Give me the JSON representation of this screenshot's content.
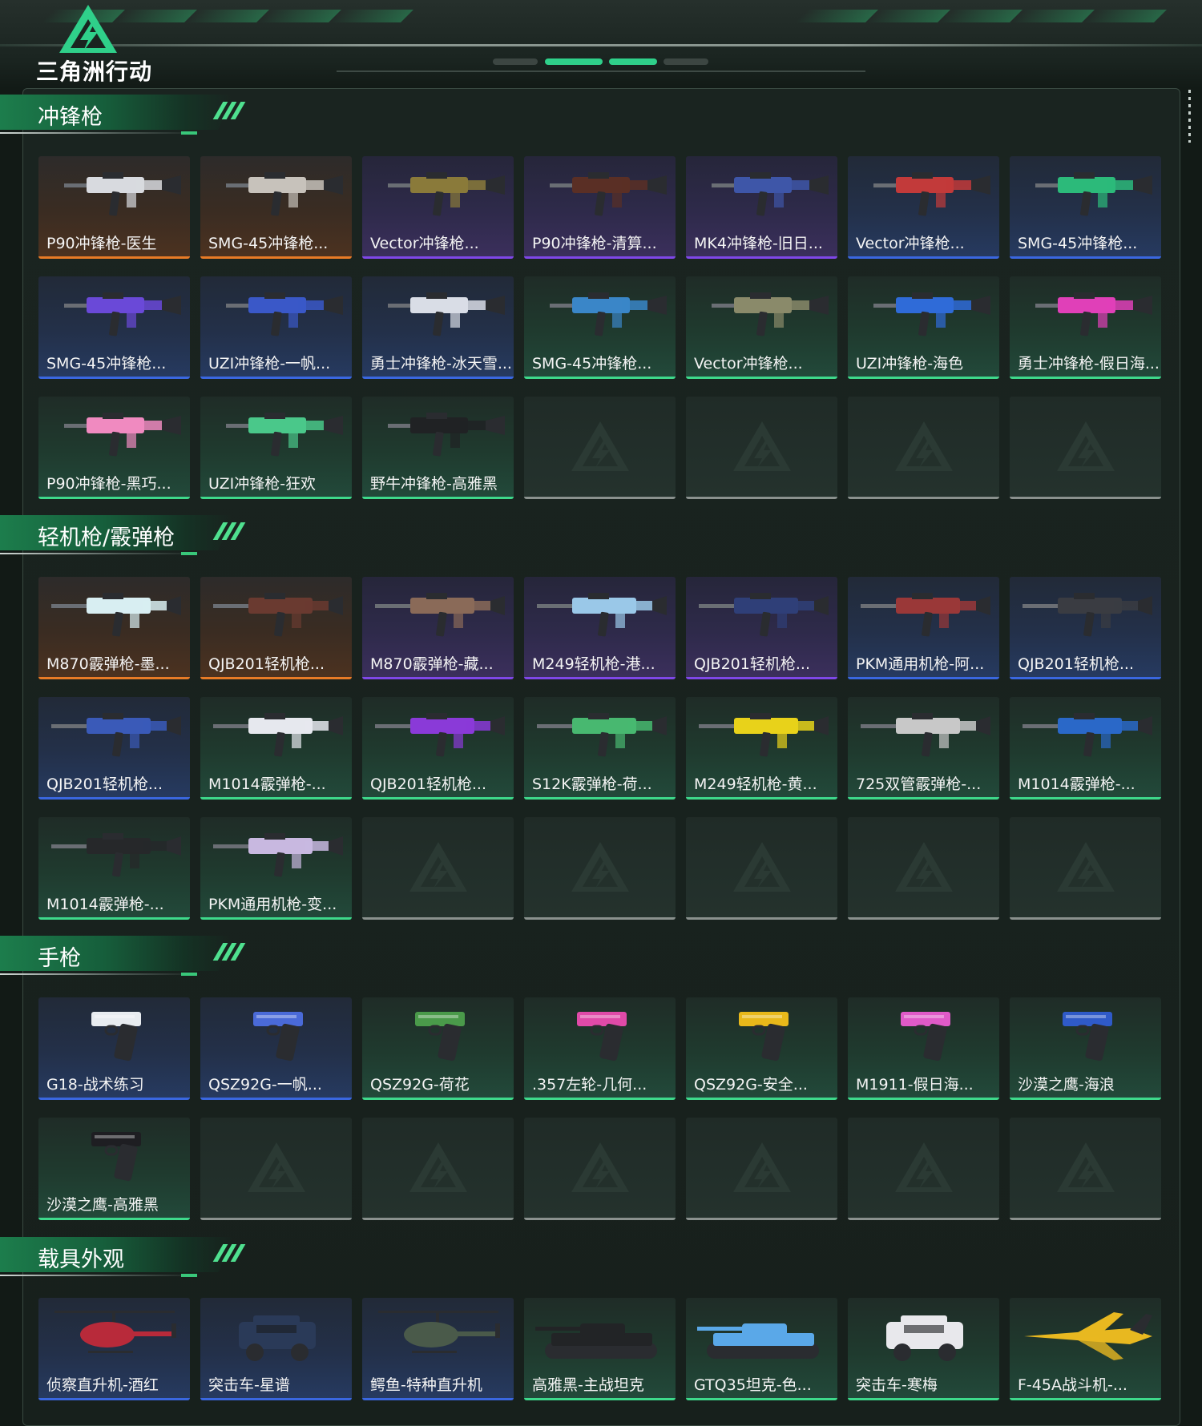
{
  "app": {
    "logo_text": "三角洲行动"
  },
  "sections": [
    {
      "title": "冲锋枪",
      "items": [
        {
          "label": "P90冲锋枪-医生",
          "rarity": "orange",
          "kind": "smg",
          "hue": "#d8dadf"
        },
        {
          "label": "SMG-45冲锋枪...",
          "rarity": "orange",
          "kind": "smg",
          "hue": "#c7c2bb"
        },
        {
          "label": "Vector冲锋枪...",
          "rarity": "purple",
          "kind": "smg",
          "hue": "#8a7a3a"
        },
        {
          "label": "P90冲锋枪-清算...",
          "rarity": "purple",
          "kind": "smg",
          "hue": "#5a2f25"
        },
        {
          "label": "MK4冲锋枪-旧日...",
          "rarity": "purple",
          "kind": "smg",
          "hue": "#3e56a8"
        },
        {
          "label": "Vector冲锋枪...",
          "rarity": "blue",
          "kind": "smg",
          "hue": "#c23a3a"
        },
        {
          "label": "SMG-45冲锋枪...",
          "rarity": "blue",
          "kind": "smg",
          "hue": "#2cba7a"
        },
        {
          "label": "SMG-45冲锋枪...",
          "rarity": "blue",
          "kind": "smg",
          "hue": "#6a49d8"
        },
        {
          "label": "UZI冲锋枪-一帆...",
          "rarity": "blue",
          "kind": "smg",
          "hue": "#3a58c8"
        },
        {
          "label": "勇士冲锋枪-冰天雪...",
          "rarity": "blue",
          "kind": "smg",
          "hue": "#d9dde6"
        },
        {
          "label": "SMG-45冲锋枪...",
          "rarity": "green",
          "kind": "smg",
          "hue": "#3a86c8"
        },
        {
          "label": "Vector冲锋枪...",
          "rarity": "green",
          "kind": "smg",
          "hue": "#8a8a6a"
        },
        {
          "label": "UZI冲锋枪-海色",
          "rarity": "green",
          "kind": "smg",
          "hue": "#2f6bd8"
        },
        {
          "label": "勇士冲锋枪-假日海...",
          "rarity": "green",
          "kind": "smg",
          "hue": "#e040b8"
        },
        {
          "label": "P90冲锋枪-黑巧...",
          "rarity": "green",
          "kind": "smg",
          "hue": "#f08ac0"
        },
        {
          "label": "UZI冲锋枪-狂欢",
          "rarity": "green",
          "kind": "smg",
          "hue": "#4ac88a"
        },
        {
          "label": "野牛冲锋枪-高雅黑",
          "rarity": "green",
          "kind": "smg",
          "hue": "#202224"
        },
        {
          "empty": true
        },
        {
          "empty": true
        },
        {
          "empty": true
        },
        {
          "empty": true
        }
      ]
    },
    {
      "title": "轻机枪/霰弹枪",
      "items": [
        {
          "label": "M870霰弹枪-墨...",
          "rarity": "orange",
          "kind": "rifle",
          "hue": "#d8eef2"
        },
        {
          "label": "QJB201轻机枪...",
          "rarity": "orange",
          "kind": "rifle",
          "hue": "#6a3a30"
        },
        {
          "label": "M870霰弹枪-藏...",
          "rarity": "purple",
          "kind": "rifle",
          "hue": "#8a6a58"
        },
        {
          "label": "M249轻机枪-港...",
          "rarity": "purple",
          "kind": "rifle",
          "hue": "#9ac8e8"
        },
        {
          "label": "QJB201轻机枪...",
          "rarity": "purple",
          "kind": "rifle",
          "hue": "#2f3f78"
        },
        {
          "label": "PKM通用机枪-阿...",
          "rarity": "blue",
          "kind": "rifle",
          "hue": "#9a3838"
        },
        {
          "label": "QJB201轻机枪...",
          "rarity": "blue",
          "kind": "rifle",
          "hue": "#3a3c42"
        },
        {
          "label": "QJB201轻机枪...",
          "rarity": "blue",
          "kind": "rifle",
          "hue": "#3a5ab8"
        },
        {
          "label": "M1014霰弹枪-...",
          "rarity": "green",
          "kind": "rifle",
          "hue": "#e6e8ee"
        },
        {
          "label": "QJB201轻机枪...",
          "rarity": "green",
          "kind": "rifle",
          "hue": "#8a3ad8"
        },
        {
          "label": "S12K霰弹枪-荷...",
          "rarity": "green",
          "kind": "rifle",
          "hue": "#48b870"
        },
        {
          "label": "M249轻机枪-黄...",
          "rarity": "green",
          "kind": "rifle",
          "hue": "#e8d21a"
        },
        {
          "label": "725双管霰弹枪-...",
          "rarity": "green",
          "kind": "rifle",
          "hue": "#c8c8c8"
        },
        {
          "label": "M1014霰弹枪-...",
          "rarity": "green",
          "kind": "rifle",
          "hue": "#2a68c8"
        },
        {
          "label": "M1014霰弹枪-...",
          "rarity": "green",
          "kind": "rifle",
          "hue": "#26282a"
        },
        {
          "label": "PKM通用机枪-变...",
          "rarity": "green",
          "kind": "rifle",
          "hue": "#c8b8e0"
        },
        {
          "empty": true
        },
        {
          "empty": true
        },
        {
          "empty": true
        },
        {
          "empty": true
        },
        {
          "empty": true
        }
      ]
    },
    {
      "title": "手枪",
      "items": [
        {
          "label": "G18-战术练习",
          "rarity": "blue",
          "kind": "pistol",
          "hue": "#e8ecf0"
        },
        {
          "label": "QSZ92G-一帆...",
          "rarity": "blue",
          "kind": "pistol",
          "hue": "#4a6ad8"
        },
        {
          "label": "QSZ92G-荷花",
          "rarity": "green",
          "kind": "pistol",
          "hue": "#4a9a4a"
        },
        {
          "label": ".357左轮-几何...",
          "rarity": "green",
          "kind": "pistol",
          "hue": "#e04aa8"
        },
        {
          "label": "QSZ92G-安全...",
          "rarity": "green",
          "kind": "pistol",
          "hue": "#e8b81a"
        },
        {
          "label": "M1911-假日海...",
          "rarity": "green",
          "kind": "pistol",
          "hue": "#e05ac8"
        },
        {
          "label": "沙漠之鹰-海浪",
          "rarity": "green",
          "kind": "pistol",
          "hue": "#2f5ac8"
        },
        {
          "label": "沙漠之鹰-高雅黑",
          "rarity": "green",
          "kind": "pistol",
          "hue": "#1e1e22"
        },
        {
          "empty": true
        },
        {
          "empty": true
        },
        {
          "empty": true
        },
        {
          "empty": true
        },
        {
          "empty": true
        },
        {
          "empty": true
        }
      ]
    },
    {
      "title": "载具外观",
      "items": [
        {
          "label": "侦察直升机-酒红",
          "rarity": "blue",
          "kind": "heli",
          "hue": "#b82a3a"
        },
        {
          "label": "突击车-星谱",
          "rarity": "blue",
          "kind": "car",
          "hue": "#2a3a58"
        },
        {
          "label": "鳄鱼-特种直升机",
          "rarity": "blue",
          "kind": "heli",
          "hue": "#4a5a4a"
        },
        {
          "label": "高雅黑-主战坦克",
          "rarity": "green",
          "kind": "tank",
          "hue": "#222426"
        },
        {
          "label": "GTQ35坦克-色...",
          "rarity": "green",
          "kind": "tank",
          "hue": "#5aa8e8"
        },
        {
          "label": "突击车-寒梅",
          "rarity": "green",
          "kind": "car",
          "hue": "#e8e8ec"
        },
        {
          "label": "F-45A战斗机-...",
          "rarity": "green",
          "kind": "jet",
          "hue": "#e8b820"
        }
      ]
    }
  ]
}
